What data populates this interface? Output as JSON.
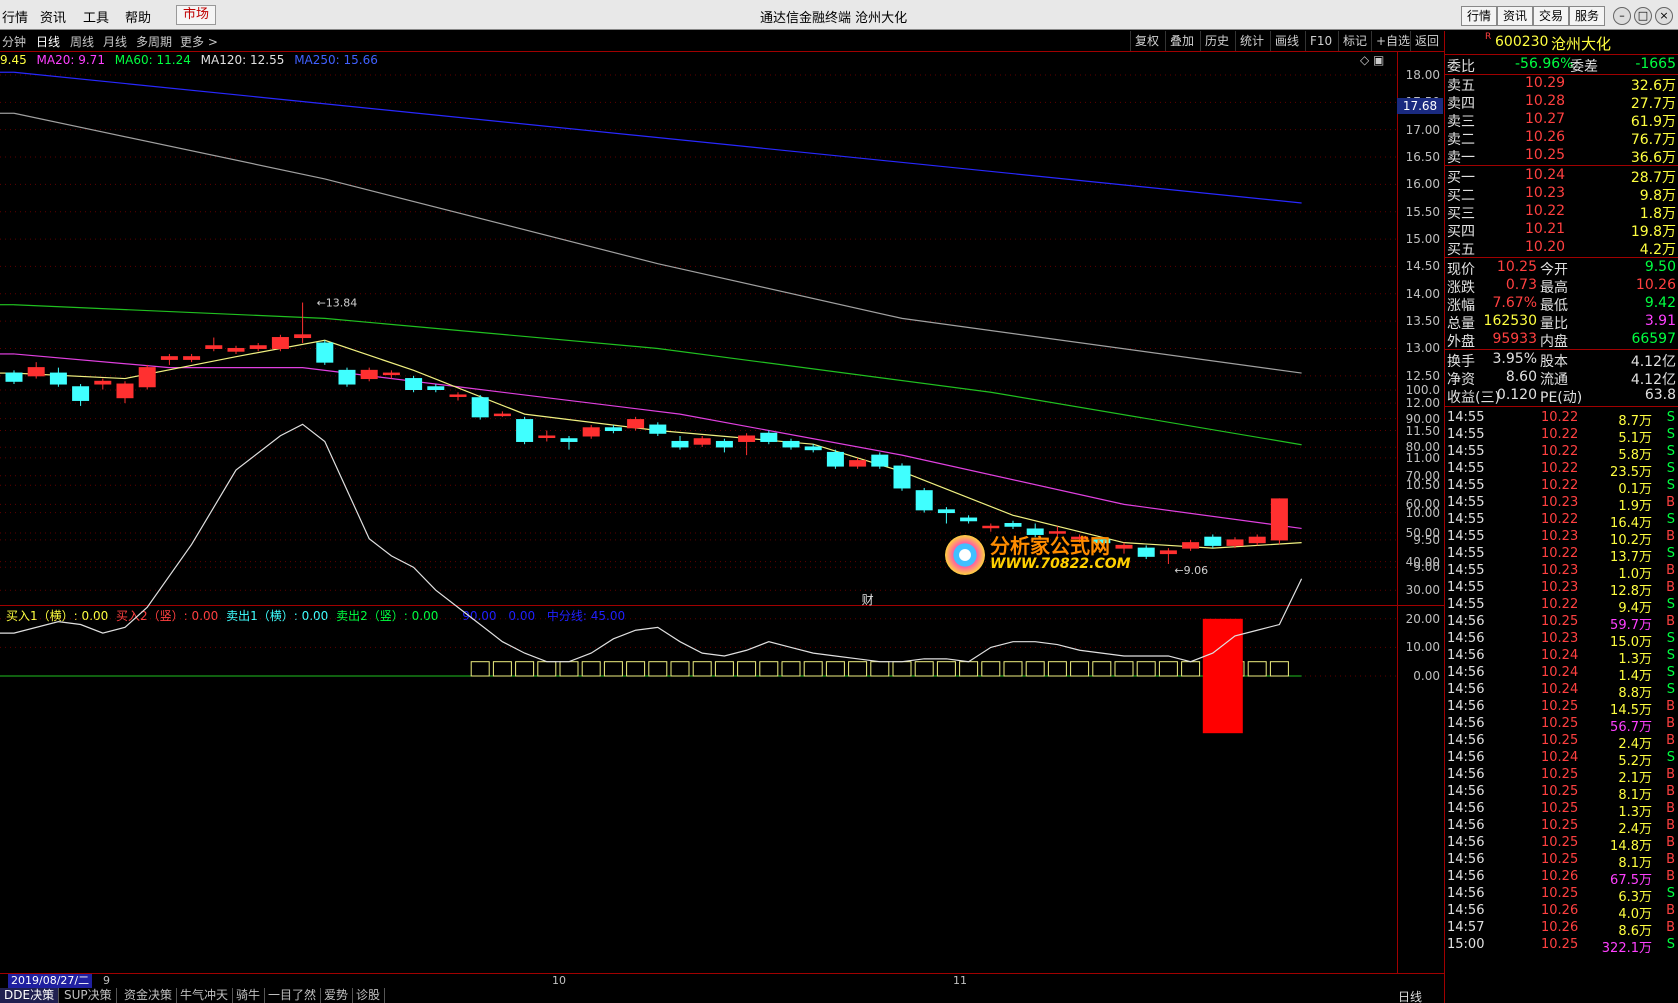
{
  "menu": {
    "items": [
      "行情",
      "资讯",
      "工具",
      "帮助"
    ],
    "market": "市场",
    "app_title": "通达信金融终端  沧州大化",
    "right_buttons": [
      "行情",
      "资讯",
      "交易",
      "服务"
    ]
  },
  "period_tabs": [
    "分钟",
    "日线",
    "周线",
    "月线",
    "多周期",
    "更多 >"
  ],
  "selected_period": "日线",
  "toolbar": [
    "复权",
    "叠加",
    "历史",
    "统计",
    "画线",
    "F10",
    "标记",
    "+自选",
    "返回"
  ],
  "ma_legend": {
    "ma5": "9.45",
    "ma20": "MA20: 9.71",
    "ma60": "MA60: 11.24",
    "ma120": "MA120: 12.55",
    "ma250": "MA250: 15.66"
  },
  "price_axis": [
    "18.00",
    "17.50",
    "17.00",
    "16.50",
    "16.00",
    "15.50",
    "15.00",
    "14.50",
    "14.00",
    "13.50",
    "13.00",
    "12.50",
    "12.00",
    "11.50",
    "11.00",
    "10.50",
    "10.00",
    "9.50",
    "9.00"
  ],
  "axis_marker": "17.68",
  "high_marker": "13.84",
  "low_marker": "9.06",
  "finance_mark": "财",
  "indicator_legend": {
    "buy1": "买入1（横）: 0.00",
    "buy2": "买入2（竖）: 0.00",
    "sell1": "卖出1（横）: 0.00",
    "sell2": "卖出2（竖）: 0.00",
    "lvl90": "90.00",
    "lvl0": "0.00",
    "mid": "中分线: 45.00"
  },
  "indicator_axis": [
    "100.0",
    "90.00",
    "80.00",
    "70.00",
    "60.00",
    "50.00",
    "40.00",
    "30.00",
    "20.00",
    "10.00",
    "0.00"
  ],
  "date_label": "2019/08/27/二",
  "month_ticks": [
    "9",
    "10",
    "11"
  ],
  "bottom_tabs": [
    "DDE决策",
    "SUP决策",
    "资金决策",
    "牛气冲天",
    "骑牛",
    "一目了然",
    "爱势",
    "诊股"
  ],
  "bottom_right": "日线",
  "watermark": {
    "line1": "分析家公式网",
    "line2": "WWW.70822.COM"
  },
  "stock": {
    "code": "600230",
    "name": "沧州大化",
    "flag": "R"
  },
  "quote": {
    "weibi_label": "委比",
    "weibi": "-56.96%",
    "weicha_label": "委差",
    "weicha": "-1665",
    "sell": [
      {
        "label": "卖五",
        "price": "10.29",
        "vol": "32.6万"
      },
      {
        "label": "卖四",
        "price": "10.28",
        "vol": "27.7万"
      },
      {
        "label": "卖三",
        "price": "10.27",
        "vol": "61.9万"
      },
      {
        "label": "卖二",
        "price": "10.26",
        "vol": "76.7万"
      },
      {
        "label": "卖一",
        "price": "10.25",
        "vol": "36.6万"
      }
    ],
    "buy": [
      {
        "label": "买一",
        "price": "10.24",
        "vol": "28.7万"
      },
      {
        "label": "买二",
        "price": "10.23",
        "vol": "9.8万"
      },
      {
        "label": "买三",
        "price": "10.22",
        "vol": "1.8万"
      },
      {
        "label": "买四",
        "price": "10.21",
        "vol": "19.8万"
      },
      {
        "label": "买五",
        "price": "10.20",
        "vol": "4.2万"
      }
    ],
    "stats": [
      {
        "l1": "现价",
        "v1": "10.25",
        "l2": "今开",
        "v2": "9.50"
      },
      {
        "l1": "涨跌",
        "v1": "0.73",
        "l2": "最高",
        "v2": "10.26"
      },
      {
        "l1": "涨幅",
        "v1": "7.67%",
        "l2": "最低",
        "v2": "9.42"
      },
      {
        "l1": "总量",
        "v1": "162530",
        "l2": "量比",
        "v2": "3.91"
      },
      {
        "l1": "外盘",
        "v1": "95933",
        "l2": "内盘",
        "v2": "66597"
      },
      {
        "l1": "换手",
        "v1": "3.95%",
        "l2": "股本",
        "v2": "4.12亿"
      },
      {
        "l1": "净资",
        "v1": "8.60",
        "l2": "流通",
        "v2": "4.12亿"
      },
      {
        "l1": "收益(三)",
        "v1": "0.120",
        "l2": "PE(动)",
        "v2": "63.8"
      }
    ]
  },
  "ticks": [
    {
      "t": "14:55",
      "p": "10.22",
      "v": "8.7万",
      "s": "S"
    },
    {
      "t": "14:55",
      "p": "10.22",
      "v": "5.1万",
      "s": "S"
    },
    {
      "t": "14:55",
      "p": "10.22",
      "v": "5.8万",
      "s": "S"
    },
    {
      "t": "14:55",
      "p": "10.22",
      "v": "23.5万",
      "s": "S"
    },
    {
      "t": "14:55",
      "p": "10.22",
      "v": "0.1万",
      "s": "S"
    },
    {
      "t": "14:55",
      "p": "10.23",
      "v": "1.9万",
      "s": "B"
    },
    {
      "t": "14:55",
      "p": "10.22",
      "v": "16.4万",
      "s": "S"
    },
    {
      "t": "14:55",
      "p": "10.23",
      "v": "10.2万",
      "s": "B"
    },
    {
      "t": "14:55",
      "p": "10.22",
      "v": "13.7万",
      "s": "S"
    },
    {
      "t": "14:55",
      "p": "10.23",
      "v": "1.0万",
      "s": "B"
    },
    {
      "t": "14:55",
      "p": "10.23",
      "v": "12.8万",
      "s": "B"
    },
    {
      "t": "14:55",
      "p": "10.22",
      "v": "9.4万",
      "s": "S"
    },
    {
      "t": "14:56",
      "p": "10.25",
      "v": "59.7万",
      "s": "B"
    },
    {
      "t": "14:56",
      "p": "10.23",
      "v": "15.0万",
      "s": "S"
    },
    {
      "t": "14:56",
      "p": "10.24",
      "v": "1.3万",
      "s": "S"
    },
    {
      "t": "14:56",
      "p": "10.24",
      "v": "1.4万",
      "s": "S"
    },
    {
      "t": "14:56",
      "p": "10.24",
      "v": "8.8万",
      "s": "S"
    },
    {
      "t": "14:56",
      "p": "10.25",
      "v": "14.5万",
      "s": "B"
    },
    {
      "t": "14:56",
      "p": "10.25",
      "v": "56.7万",
      "s": "B"
    },
    {
      "t": "14:56",
      "p": "10.25",
      "v": "2.4万",
      "s": "B"
    },
    {
      "t": "14:56",
      "p": "10.24",
      "v": "5.2万",
      "s": "S"
    },
    {
      "t": "14:56",
      "p": "10.25",
      "v": "2.1万",
      "s": "B"
    },
    {
      "t": "14:56",
      "p": "10.25",
      "v": "8.1万",
      "s": "B"
    },
    {
      "t": "14:56",
      "p": "10.25",
      "v": "1.3万",
      "s": "B"
    },
    {
      "t": "14:56",
      "p": "10.25",
      "v": "2.4万",
      "s": "B"
    },
    {
      "t": "14:56",
      "p": "10.25",
      "v": "14.8万",
      "s": "B"
    },
    {
      "t": "14:56",
      "p": "10.25",
      "v": "8.1万",
      "s": "B"
    },
    {
      "t": "14:56",
      "p": "10.26",
      "v": "67.5万",
      "s": "B"
    },
    {
      "t": "14:56",
      "p": "10.25",
      "v": "6.3万",
      "s": "S"
    },
    {
      "t": "14:56",
      "p": "10.26",
      "v": "4.0万",
      "s": "B"
    },
    {
      "t": "14:57",
      "p": "10.26",
      "v": "8.6万",
      "s": "B"
    },
    {
      "t": "15:00",
      "p": "10.25",
      "v": "322.1万",
      "s": "S"
    }
  ],
  "candles": [
    [
      12.55,
      12.4,
      12.6,
      12.35
    ],
    [
      12.5,
      12.65,
      12.75,
      12.45
    ],
    [
      12.55,
      12.35,
      12.65,
      12.3
    ],
    [
      12.3,
      12.05,
      12.35,
      11.95
    ],
    [
      12.35,
      12.4,
      12.45,
      12.25
    ],
    [
      12.1,
      12.35,
      12.4,
      12.0
    ],
    [
      12.3,
      12.65,
      12.7,
      12.25
    ],
    [
      12.8,
      12.85,
      12.9,
      12.7
    ],
    [
      12.8,
      12.85,
      12.9,
      12.75
    ],
    [
      13.0,
      13.05,
      13.2,
      12.95
    ],
    [
      12.95,
      13.0,
      13.05,
      12.9
    ],
    [
      13.0,
      13.05,
      13.1,
      12.95
    ],
    [
      13.0,
      13.2,
      13.25,
      12.95
    ],
    [
      13.2,
      13.25,
      13.84,
      13.1
    ],
    [
      13.1,
      12.75,
      13.15,
      12.7
    ],
    [
      12.6,
      12.35,
      12.65,
      12.3
    ],
    [
      12.45,
      12.6,
      12.65,
      12.4
    ],
    [
      12.55,
      12.55,
      12.6,
      12.45
    ],
    [
      12.45,
      12.25,
      12.5,
      12.2
    ],
    [
      12.3,
      12.25,
      12.35,
      12.2
    ],
    [
      12.15,
      12.15,
      12.2,
      12.05
    ],
    [
      12.1,
      11.75,
      12.15,
      11.7
    ],
    [
      11.8,
      11.8,
      11.85,
      11.75
    ],
    [
      11.7,
      11.3,
      11.75,
      11.25
    ],
    [
      11.4,
      11.4,
      11.5,
      11.3
    ],
    [
      11.35,
      11.3,
      11.4,
      11.15
    ],
    [
      11.4,
      11.55,
      11.6,
      11.35
    ],
    [
      11.55,
      11.5,
      11.6,
      11.45
    ],
    [
      11.55,
      11.7,
      11.75,
      11.5
    ],
    [
      11.6,
      11.45,
      11.65,
      11.4
    ],
    [
      11.3,
      11.2,
      11.4,
      11.15
    ],
    [
      11.25,
      11.35,
      11.4,
      11.2
    ],
    [
      11.3,
      11.2,
      11.35,
      11.1
    ],
    [
      11.3,
      11.4,
      11.45,
      11.05
    ],
    [
      11.45,
      11.3,
      11.5,
      11.25
    ],
    [
      11.3,
      11.2,
      11.35,
      11.15
    ],
    [
      11.2,
      11.15,
      11.25,
      11.1
    ],
    [
      11.1,
      10.85,
      11.15,
      10.8
    ],
    [
      10.85,
      10.95,
      11.0,
      10.8
    ],
    [
      11.05,
      10.85,
      11.1,
      10.8
    ],
    [
      10.85,
      10.45,
      10.9,
      10.4
    ],
    [
      10.4,
      10.05,
      10.45,
      10.0
    ],
    [
      10.05,
      10.0,
      10.1,
      9.8
    ],
    [
      9.9,
      9.85,
      9.95,
      9.8
    ],
    [
      9.75,
      9.75,
      9.8,
      9.65
    ],
    [
      9.8,
      9.75,
      9.85,
      9.7
    ],
    [
      9.7,
      9.6,
      9.8,
      9.55
    ],
    [
      9.65,
      9.65,
      9.75,
      9.55
    ],
    [
      9.55,
      9.55,
      9.6,
      9.45
    ],
    [
      9.5,
      9.45,
      9.55,
      9.4
    ],
    [
      9.35,
      9.4,
      9.45,
      9.25
    ],
    [
      9.35,
      9.2,
      9.4,
      9.15
    ],
    [
      9.25,
      9.3,
      9.35,
      9.06
    ],
    [
      9.35,
      9.45,
      9.5,
      9.3
    ],
    [
      9.55,
      9.4,
      9.6,
      9.35
    ],
    [
      9.4,
      9.5,
      9.55,
      9.35
    ],
    [
      9.45,
      9.55,
      9.6,
      9.4
    ],
    [
      9.5,
      10.25,
      10.26,
      9.42
    ]
  ],
  "ma_series": {
    "ma250": [
      [
        0,
        18.05
      ],
      [
        58,
        15.66
      ]
    ],
    "ma120": [
      [
        0,
        17.3
      ],
      [
        14,
        16.1
      ],
      [
        29,
        14.55
      ],
      [
        40,
        13.55
      ],
      [
        58,
        12.55
      ]
    ],
    "ma60": [
      [
        0,
        13.8
      ],
      [
        14,
        13.55
      ],
      [
        29,
        13.0
      ],
      [
        44,
        12.2
      ],
      [
        58,
        11.24
      ]
    ],
    "ma20": [
      [
        0,
        12.9
      ],
      [
        7,
        12.65
      ],
      [
        13,
        12.65
      ],
      [
        20,
        12.3
      ],
      [
        30,
        11.8
      ],
      [
        40,
        11.05
      ],
      [
        50,
        10.15
      ],
      [
        58,
        9.71
      ]
    ],
    "ma5": [
      [
        0,
        12.55
      ],
      [
        5,
        12.45
      ],
      [
        10,
        12.85
      ],
      [
        14,
        13.15
      ],
      [
        18,
        12.6
      ],
      [
        23,
        11.8
      ],
      [
        29,
        11.5
      ],
      [
        36,
        11.25
      ],
      [
        40,
        10.75
      ],
      [
        45,
        9.95
      ],
      [
        50,
        9.45
      ],
      [
        54,
        9.35
      ],
      [
        58,
        9.45
      ]
    ]
  },
  "indicator_line": [
    [
      0,
      15
    ],
    [
      2,
      19
    ],
    [
      3,
      18
    ],
    [
      4,
      15
    ],
    [
      5,
      17
    ],
    [
      6,
      24
    ],
    [
      8,
      46
    ],
    [
      10,
      72
    ],
    [
      12,
      84
    ],
    [
      13,
      88
    ],
    [
      14,
      82
    ],
    [
      15,
      65
    ],
    [
      16,
      48
    ],
    [
      17,
      42
    ],
    [
      18,
      38
    ],
    [
      19,
      30
    ],
    [
      20,
      24
    ],
    [
      21,
      18
    ],
    [
      22,
      12
    ],
    [
      23,
      8
    ],
    [
      24,
      5
    ],
    [
      25,
      5
    ],
    [
      26,
      8
    ],
    [
      27,
      13
    ],
    [
      28,
      16
    ],
    [
      29,
      17
    ],
    [
      30,
      12
    ],
    [
      31,
      8
    ],
    [
      32,
      7
    ],
    [
      33,
      9
    ],
    [
      34,
      12
    ],
    [
      35,
      10
    ],
    [
      36,
      8
    ],
    [
      37,
      7
    ],
    [
      38,
      6
    ],
    [
      39,
      5
    ],
    [
      40,
      5
    ],
    [
      41,
      6
    ],
    [
      42,
      6
    ],
    [
      43,
      5
    ],
    [
      44,
      10
    ],
    [
      45,
      12
    ],
    [
      46,
      12
    ],
    [
      47,
      11
    ],
    [
      48,
      9
    ],
    [
      49,
      8
    ],
    [
      50,
      7
    ],
    [
      51,
      7
    ],
    [
      52,
      7
    ],
    [
      53,
      5
    ],
    [
      54,
      8
    ],
    [
      55,
      14
    ],
    [
      56,
      16
    ],
    [
      57,
      18
    ],
    [
      58,
      34
    ]
  ],
  "indicator_bar": {
    "index": 54,
    "value": 20
  },
  "indicator_boxes": {
    "from": 21,
    "to": 57
  }
}
